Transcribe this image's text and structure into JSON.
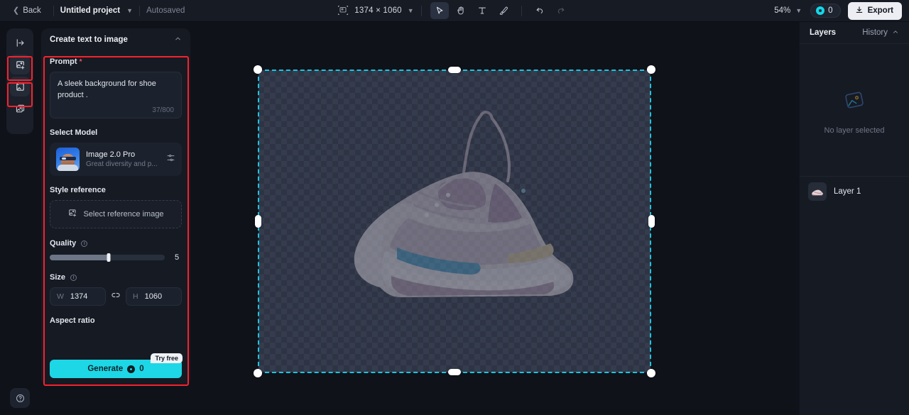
{
  "topbar": {
    "back_label": "Back",
    "project_name": "Untitled project",
    "autosave_status": "Autosaved",
    "canvas_dimensions": "1374 × 1060",
    "zoom_level": "54%",
    "credits_count": "0",
    "export_label": "Export",
    "tools": [
      {
        "name": "select-tool",
        "glyph": "cursor",
        "active": true
      },
      {
        "name": "hand-tool",
        "glyph": "hand",
        "active": false
      },
      {
        "name": "text-tool",
        "glyph": "T",
        "active": false
      },
      {
        "name": "brush-tool",
        "glyph": "brush",
        "active": false
      },
      {
        "name": "undo-tool",
        "glyph": "undo",
        "active": false
      },
      {
        "name": "redo-tool",
        "glyph": "redo",
        "active": false
      }
    ]
  },
  "rail": {
    "items": [
      {
        "name": "collapse-panel-icon",
        "highlighted": false
      },
      {
        "name": "text-to-image-icon",
        "highlighted": true
      },
      {
        "name": "image-to-image-icon",
        "highlighted": true
      },
      {
        "name": "layers-stack-icon",
        "highlighted": false
      }
    ],
    "help_label": "?"
  },
  "panel": {
    "title": "Create text to image",
    "prompt": {
      "label": "Prompt",
      "required_marker": "*",
      "value": "A sleek background for shoe product .",
      "counter": "37/800"
    },
    "model": {
      "label": "Select Model",
      "name": "Image 2.0 Pro",
      "description": "Great diversity and p...",
      "settings_icon": "sliders-icon"
    },
    "style_reference": {
      "label": "Style reference",
      "placeholder": "Select reference image"
    },
    "quality": {
      "label": "Quality",
      "value": "5",
      "percent": 51
    },
    "size": {
      "label": "Size",
      "width_key": "W",
      "width_value": "1374",
      "height_key": "H",
      "height_value": "1060",
      "link_icon": "broken-link-icon"
    },
    "aspect_ratio_label": "Aspect ratio",
    "generate": {
      "label": "Generate",
      "cost": "0",
      "badge": "Try free"
    },
    "accent_highlight_color": "#f5222d"
  },
  "right_panel": {
    "layers_tab": "Layers",
    "history_tab": "History",
    "empty_state": "No layer selected",
    "layers": [
      {
        "name": "Layer 1"
      }
    ]
  },
  "colors": {
    "accent_cyan": "#1ed7e6",
    "selection_cyan": "#19c6e0",
    "highlight_red": "#f5222d",
    "panel_bg": "#161a23",
    "app_bg": "#0f1219"
  }
}
